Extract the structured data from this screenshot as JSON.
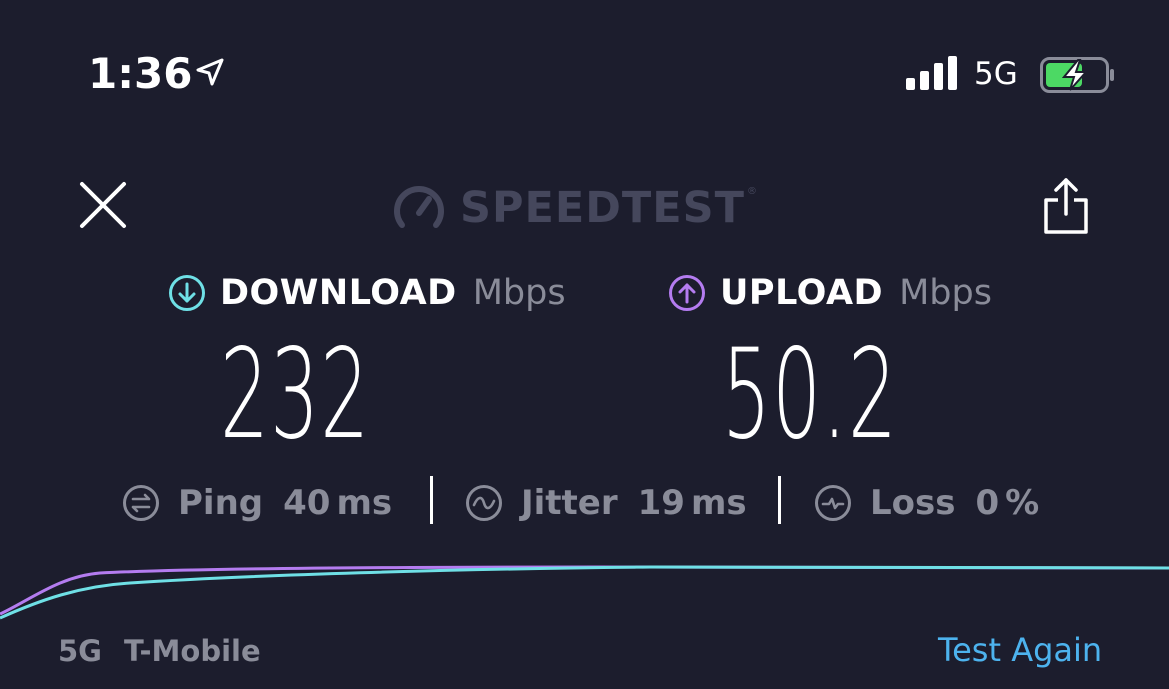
{
  "status_bar": {
    "time": "1:36",
    "network": "5G",
    "icons": [
      "location-arrow-icon",
      "signal-bars-icon",
      "battery-charging-icon"
    ]
  },
  "header": {
    "logo_text": "SPEEDTEST",
    "logo_reg": "®",
    "icons": [
      "close-icon",
      "speedtest-gauge-icon",
      "share-icon"
    ]
  },
  "download": {
    "label": "DOWNLOAD",
    "unit": "Mbps",
    "value": "232",
    "icon": "arrow-down-circle-icon"
  },
  "upload": {
    "label": "UPLOAD",
    "unit": "Mbps",
    "value": "50.2",
    "icon": "arrow-up-circle-icon"
  },
  "stats": {
    "ping": {
      "label": "Ping",
      "value": "40",
      "unit": "ms",
      "icon": "ping-icon"
    },
    "jitter": {
      "label": "Jitter",
      "value": "19",
      "unit": "ms",
      "icon": "jitter-icon"
    },
    "loss": {
      "label": "Loss",
      "value": "0",
      "unit": "%",
      "icon": "loss-icon"
    }
  },
  "footer": {
    "network_type": "5G",
    "carrier": "T-Mobile",
    "test_again": "Test Again"
  },
  "colors": {
    "background": "#1c1d2d",
    "download_accent": "#6fe0e6",
    "upload_accent": "#b47cf0",
    "link": "#4db3ee",
    "muted": "#8a8c99",
    "logo": "#45475c",
    "battery_fill": "#4cd964"
  }
}
